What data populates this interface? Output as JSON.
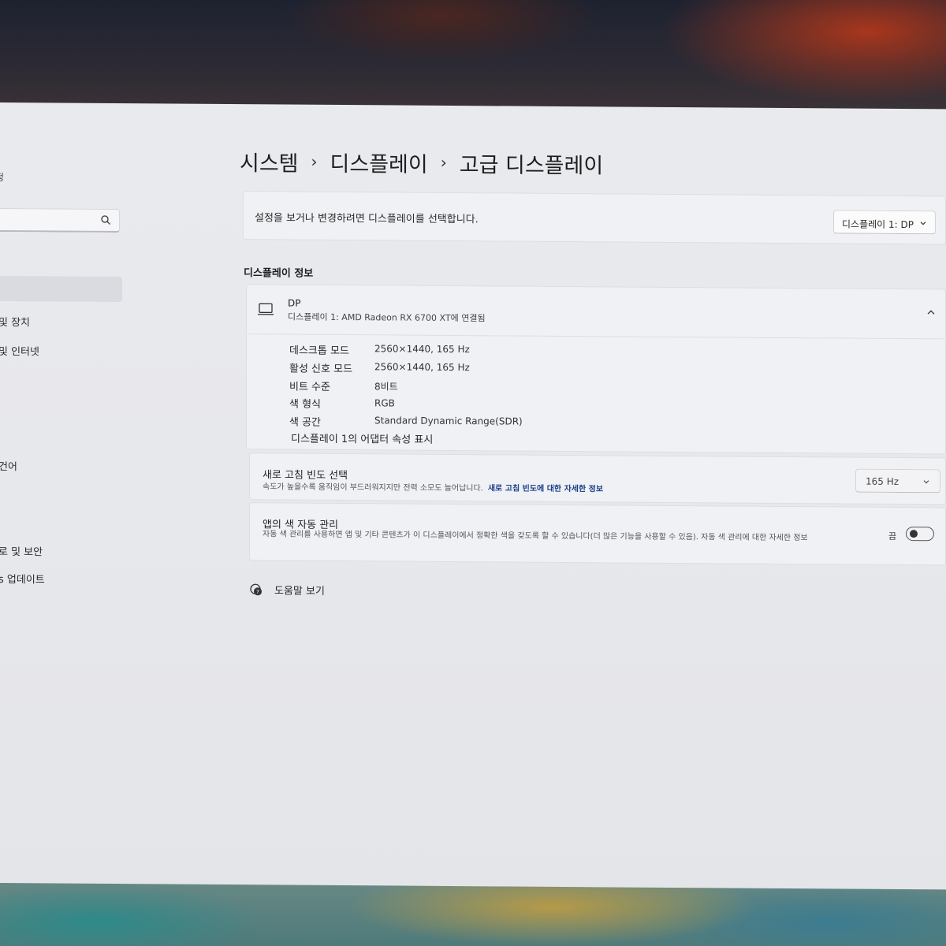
{
  "sidebar": {
    "title_fragment": "정",
    "items": [
      {
        "label": "및 장치"
      },
      {
        "label": "및 인터넷"
      },
      {
        "label": "건어"
      },
      {
        "label": "로 및 보안"
      },
      {
        "label": "s 업데이트"
      }
    ]
  },
  "breadcrumb": {
    "items": [
      "시스템",
      "디스플레이",
      "고급 디스플레이"
    ],
    "separator": "›"
  },
  "select_display": {
    "prompt": "설정을 보거나 변경하려면 디스플레이를 선택합니다.",
    "selected": "디스플레이 1: DP"
  },
  "display_info": {
    "heading": "디스플레이 정보",
    "device_name": "DP",
    "device_sub": "디스플레이 1: AMD Radeon RX 6700 XT에 연결됨",
    "rows": [
      {
        "label": "데스크톱 모드",
        "value": "2560×1440, 165 Hz"
      },
      {
        "label": "활성 신호 모드",
        "value": "2560×1440, 165 Hz"
      },
      {
        "label": "비트 수준",
        "value": "8비트"
      },
      {
        "label": "색 형식",
        "value": "RGB"
      },
      {
        "label": "색 공간",
        "value": "Standard Dynamic Range(SDR)"
      }
    ],
    "adapter_link": "디스플레이 1의 어댑터 속성 표시"
  },
  "refresh_rate": {
    "title": "새로 고침 빈도 선택",
    "description": "속도가 높을수록 움직임이 부드러워지지만 전력 소모도 늘어납니다.",
    "link": "새로 고침 빈도에 대한 자세한 정보",
    "selected": "165 Hz"
  },
  "auto_color": {
    "title": "앱의 색 자동 관리",
    "description": "자동 색 관리를 사용하면 앱 및 기타 콘텐츠가 이 디스플레이에서 정확한 색을 갖도록 할 수 있습니다(더 많은 기능을 사용할 수 있음). 자동 색 관리에 대한 자세한 정보",
    "toggle_label": "끔",
    "enabled": false
  },
  "help": {
    "label": "도움말 보기"
  }
}
